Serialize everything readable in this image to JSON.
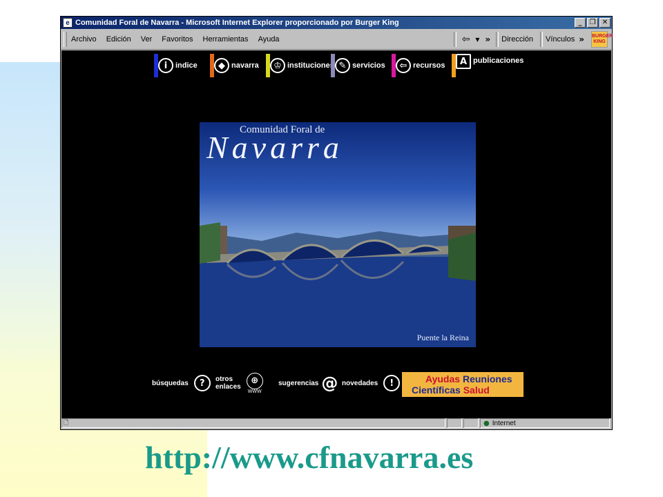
{
  "window": {
    "title": "Comunidad Foral de Navarra - Microsoft Internet Explorer proporcionado por Burger King",
    "buttons": [
      "_",
      "❐",
      "✕"
    ]
  },
  "menu": {
    "items": [
      "Archivo",
      "Edición",
      "Ver",
      "Favoritos",
      "Herramientas",
      "Ayuda"
    ],
    "toolbar_more": "»",
    "address_label": "Dirección",
    "links_label": "Vínculos",
    "links_more": "»",
    "logo_text": "BURGER KING"
  },
  "topnav": [
    {
      "label": "indice",
      "icon": "i",
      "color": "#1d2fd6"
    },
    {
      "label": "navarra",
      "icon": "◆",
      "color": "#e06a1a"
    },
    {
      "label": "instituciones",
      "icon": "♔",
      "color": "#d7d720"
    },
    {
      "label": "servicios",
      "icon": "✎",
      "color": "#8b8bb8"
    },
    {
      "label": "recursos",
      "icon": "⇦",
      "color": "#d81aa0"
    },
    {
      "label": "publicaciones",
      "icon": "A",
      "color": "#f0a020"
    }
  ],
  "hero": {
    "title_small": "Comunidad Foral de",
    "title_big": "Navarra",
    "caption": "Puente la Reina"
  },
  "bottomnav": [
    {
      "label": "búsquedas",
      "icon": "?"
    },
    {
      "label_line1": "otros",
      "label_line2": "enlaces",
      "icon": "🌐",
      "sub": "WWW"
    },
    {
      "label": "sugerencias",
      "icon": "@"
    },
    {
      "label": "novedades",
      "icon": "!"
    }
  ],
  "ayudas": {
    "w1": "Ayudas",
    "w2": "Reuniones",
    "w3": "Científicas",
    "w4": "Salud"
  },
  "status": {
    "zone": "Internet"
  },
  "url": "http://www.cfnavarra.es"
}
